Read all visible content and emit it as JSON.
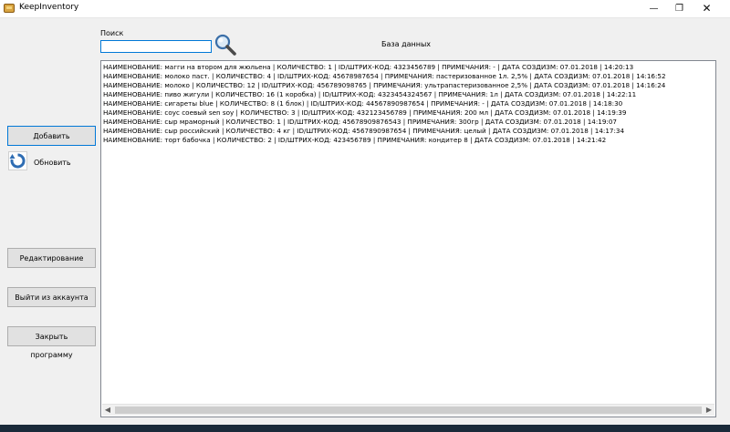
{
  "window": {
    "title": "KeepInventory",
    "minimize_glyph": "—",
    "maximize_glyph": "❐",
    "close_glyph": "✕"
  },
  "search": {
    "label": "Поиск",
    "value": "",
    "icon": "search-icon"
  },
  "database_label": "База данных",
  "buttons": {
    "add": "Добавить",
    "refresh": "Обновить",
    "edit": "Редактирование",
    "logout": "Выйти из аккаунта",
    "close_program": "Закрыть программу"
  },
  "records": [
    "НАИМЕНОВАНИЕ: магги на втором для жюльена | КОЛИЧЕСТВО: 1 | ID/ШТРИХ-КОД: 4323456789 | ПРИМЕЧАНИЯ: - | ДАТА СОЗДИЗМ: 07.01.2018 | 14:20:13",
    "НАИМЕНОВАНИЕ: молоко паст. | КОЛИЧЕСТВО: 4 | ID/ШТРИХ-КОД: 45678987654 | ПРИМЕЧАНИЯ: пастеризованное 1л. 2,5% | ДАТА СОЗДИЗМ: 07.01.2018 | 14:16:52",
    "НАИМЕНОВАНИЕ: молоко | КОЛИЧЕСТВО: 12 | ID/ШТРИХ-КОД: 456789098765 | ПРИМЕЧАНИЯ: ультрапастеризованное 2,5% | ДАТА СОЗДИЗМ: 07.01.2018 | 14:16:24",
    "НАИМЕНОВАНИЕ: пиво жигули | КОЛИЧЕСТВО: 16 (1 коробка) | ID/ШТРИХ-КОД: 4323454324567 | ПРИМЕЧАНИЯ: 1л | ДАТА СОЗДИЗМ: 07.01.2018 | 14:22:11",
    "НАИМЕНОВАНИЕ: сигареты blue | КОЛИЧЕСТВО: 8 (1 блок) | ID/ШТРИХ-КОД: 44567890987654 | ПРИМЕЧАНИЯ: - | ДАТА СОЗДИЗМ: 07.01.2018 | 14:18:30",
    "НАИМЕНОВАНИЕ: соус соевый sen soy | КОЛИЧЕСТВО: 3 | ID/ШТРИХ-КОД: 432123456789 | ПРИМЕЧАНИЯ: 200 мл | ДАТА СОЗДИЗМ: 07.01.2018 | 14:19:39",
    "НАИМЕНОВАНИЕ: сыр мраморный | КОЛИЧЕСТВО: 1 | ID/ШТРИХ-КОД: 45678909876543 | ПРИМЕЧАНИЯ: 300гр | ДАТА СОЗДИЗМ: 07.01.2018 | 14:19:07",
    "НАИМЕНОВАНИЕ: сыр российский | КОЛИЧЕСТВО: 4 кг | ID/ШТРИХ-КОД: 4567890987654 | ПРИМЕЧАНИЯ: целый | ДАТА СОЗДИЗМ: 07.01.2018 | 14:17:34",
    "НАИМЕНОВАНИЕ: торт бабочка | КОЛИЧЕСТВО: 2 | ID/ШТРИХ-КОД: 423456789 | ПРИМЕЧАНИЯ: кондитер 8 | ДАТА СОЗДИЗМ: 07.01.2018 | 14:21:42"
  ],
  "scrollbar": {
    "left_arrow": "◀",
    "right_arrow": "▶"
  },
  "colors": {
    "accent": "#0078d7",
    "window_bg": "#f0f0f0",
    "button_bg": "#e1e1e1"
  }
}
